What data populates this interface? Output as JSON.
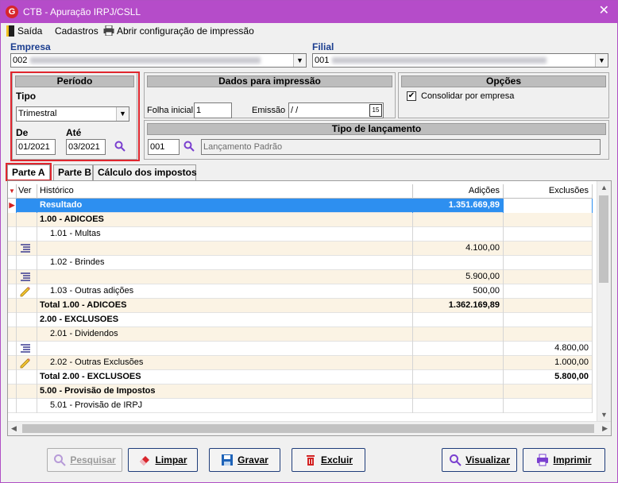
{
  "window": {
    "title": "CTB - Apuração IRPJ/CSLL",
    "app_icon_letter": "G",
    "close_glyph": "✕"
  },
  "menu": {
    "saida": "Saída",
    "cadastros": "Cadastros",
    "abrir_config": "Abrir configuração de impressão"
  },
  "empresa": {
    "label": "Empresa",
    "value": "002"
  },
  "filial": {
    "label": "Filial",
    "value": "001"
  },
  "periodo": {
    "header": "Período",
    "tipo_label": "Tipo",
    "tipo_value": "Trimestral",
    "de_label": "De",
    "ate_label": "Até",
    "de_value": "01/2021",
    "ate_value": "03/2021"
  },
  "dados_impressao": {
    "header": "Dados para impressão",
    "folha_label": "Folha inicial",
    "folha_value": "1",
    "emissao_label": "Emissão",
    "emissao_value": " / /",
    "calendar_glyph": "15"
  },
  "opcoes": {
    "header": "Opções",
    "consolidar_label": "Consolidar por empresa",
    "consolidar_checked": true
  },
  "tipo_lancamento": {
    "header": "Tipo de lançamento",
    "code": "001",
    "description": "Lançamento Padrão"
  },
  "tabs": [
    "Parte A",
    "Parte B",
    "Cálculo dos impostos"
  ],
  "grid": {
    "columns": {
      "ver": "Ver",
      "historico": "Histórico",
      "adicoes": "Adições",
      "exclusoes": "Exclusões"
    },
    "rows": [
      {
        "historico": "Resultado",
        "adicoes": "1.351.669,89",
        "exclusoes": "",
        "style": "selected",
        "icon": ""
      },
      {
        "historico": "1.00 - ADICOES",
        "adicoes": "",
        "exclusoes": "",
        "style": "beige-bold",
        "icon": ""
      },
      {
        "historico": "1.01 - Multas",
        "adicoes": "",
        "exclusoes": "",
        "style": "indent",
        "icon": ""
      },
      {
        "historico": "",
        "adicoes": "4.100,00",
        "exclusoes": "",
        "style": "beige",
        "icon": "list"
      },
      {
        "historico": "1.02 - Brindes",
        "adicoes": "",
        "exclusoes": "",
        "style": "indent",
        "icon": ""
      },
      {
        "historico": "",
        "adicoes": "5.900,00",
        "exclusoes": "",
        "style": "beige",
        "icon": "list"
      },
      {
        "historico": "1.03 - Outras adições",
        "adicoes": "500,00",
        "exclusoes": "",
        "style": "indent",
        "icon": "pencil"
      },
      {
        "historico": "Total 1.00 - ADICOES",
        "adicoes": "1.362.169,89",
        "exclusoes": "",
        "style": "beige-bold",
        "icon": ""
      },
      {
        "historico": "2.00 - EXCLUSOES",
        "adicoes": "",
        "exclusoes": "",
        "style": "bold",
        "icon": ""
      },
      {
        "historico": "2.01 - Dividendos",
        "adicoes": "",
        "exclusoes": "",
        "style": "beige-indent",
        "icon": ""
      },
      {
        "historico": "",
        "adicoes": "",
        "exclusoes": "4.800,00",
        "style": "plain",
        "icon": "list"
      },
      {
        "historico": "2.02 - Outras Exclusões",
        "adicoes": "",
        "exclusoes": "1.000,00",
        "style": "beige-indent",
        "icon": "pencil"
      },
      {
        "historico": "Total 2.00 - EXCLUSOES",
        "adicoes": "",
        "exclusoes": "5.800,00",
        "style": "bold",
        "icon": ""
      },
      {
        "historico": "5.00 - Provisão de Impostos",
        "adicoes": "",
        "exclusoes": "",
        "style": "beige-bold",
        "icon": ""
      },
      {
        "historico": "5.01 - Provisão de IRPJ",
        "adicoes": "",
        "exclusoes": "",
        "style": "indent",
        "icon": ""
      }
    ]
  },
  "buttons": {
    "pesquisar": "Pesquisar",
    "limpar": "Limpar",
    "gravar": "Gravar",
    "excluir": "Excluir",
    "visualizar": "Visualizar",
    "imprimir": "Imprimir"
  },
  "colors": {
    "titlebar": "#b54cc9",
    "selection": "#2d8ff0",
    "highlight_box": "#e0262e",
    "label_blue": "#1a3d8f"
  }
}
